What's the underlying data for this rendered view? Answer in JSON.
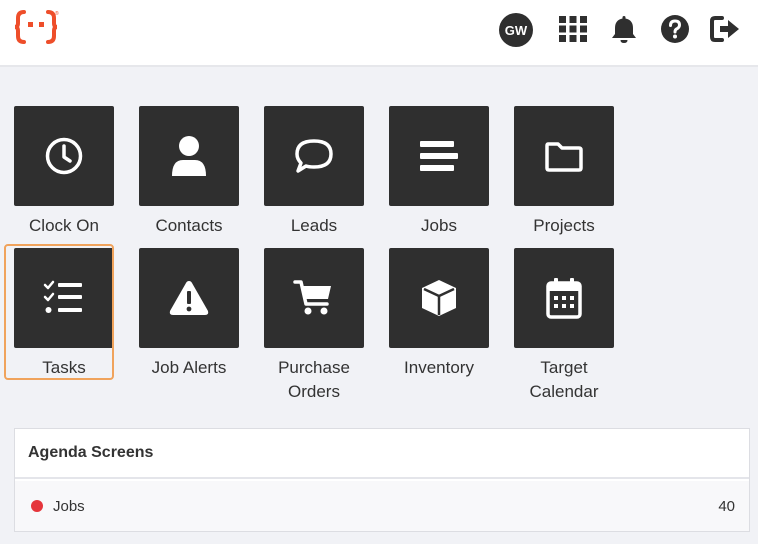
{
  "header": {
    "avatar_initials": "GW",
    "icons": [
      "apps-grid-icon",
      "bell-icon",
      "help-icon",
      "logout-icon"
    ],
    "brand_color": "#ee4e2a"
  },
  "tiles": [
    {
      "label": "Clock On",
      "icon": "clock-icon"
    },
    {
      "label": "Contacts",
      "icon": "user-icon"
    },
    {
      "label": "Leads",
      "icon": "chat-bubble-icon"
    },
    {
      "label": "Jobs",
      "icon": "lines-icon"
    },
    {
      "label": "Projects",
      "icon": "folder-icon"
    },
    {
      "label": "Tasks",
      "icon": "checklist-icon",
      "selected": true
    },
    {
      "label": "Job Alerts",
      "icon": "warning-icon"
    },
    {
      "label": "Purchase Orders",
      "icon": "cart-icon"
    },
    {
      "label": "Inventory",
      "icon": "box-icon"
    },
    {
      "label": "Target Calendar",
      "icon": "calendar-icon"
    }
  ],
  "agenda": {
    "title": "Agenda Screens",
    "rows": [
      {
        "label": "Jobs",
        "count": "40",
        "dot_color": "#e5353b"
      }
    ]
  }
}
